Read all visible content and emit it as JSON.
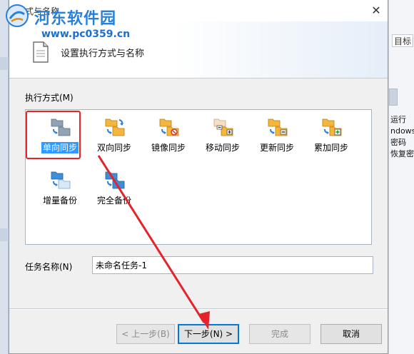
{
  "background": {
    "tab_label": "目标目",
    "text_lines": [
      "运行",
      "ndows.",
      "密码",
      "恢复密"
    ]
  },
  "watermark": {
    "brand": "河东软件园",
    "url": "www.pc0359.cn"
  },
  "dialog": {
    "title": "方式与名称",
    "header_title": "设置执行方式与名称",
    "mode_section_label": "执行方式(M)",
    "modes": [
      {
        "label": "单向同步",
        "icon": "one-way-sync-icon",
        "selected": true
      },
      {
        "label": "双向同步",
        "icon": "two-way-sync-icon",
        "selected": false
      },
      {
        "label": "镜像同步",
        "icon": "mirror-sync-icon",
        "selected": false
      },
      {
        "label": "移动同步",
        "icon": "move-sync-icon",
        "selected": false
      },
      {
        "label": "更新同步",
        "icon": "update-sync-icon",
        "selected": false
      },
      {
        "label": "累加同步",
        "icon": "cumulative-sync-icon",
        "selected": false
      },
      {
        "label": "增量备份",
        "icon": "incremental-backup-icon",
        "selected": false
      },
      {
        "label": "完全备份",
        "icon": "full-backup-icon",
        "selected": false
      }
    ],
    "task_name_label": "任务名称(N)",
    "task_name_value": "未命名任务-1",
    "buttons": {
      "prev": "< 上一步(B)",
      "next": "下一步(N) >",
      "finish": "完成",
      "cancel": "取消"
    }
  },
  "colors": {
    "selection_blue": "#3399ff",
    "highlight_red": "#e3252b",
    "watermark_blue": "#2a7fd6"
  }
}
